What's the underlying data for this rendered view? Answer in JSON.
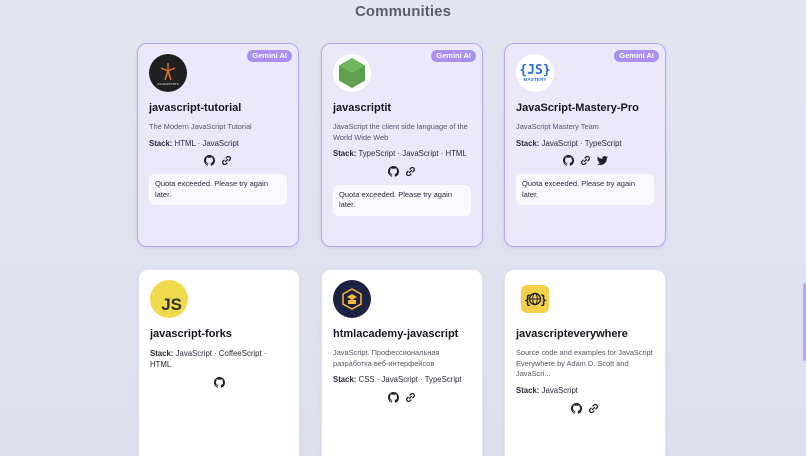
{
  "page": {
    "title": "Communities"
  },
  "cards": [
    {
      "name": "javascript-tutorial",
      "badge": "Gemini AI",
      "avatar_text": "JAVASCRIPT.INFO",
      "description": "The Modern JavaScript Tutorial",
      "stack_label": "Stack:",
      "stack": "HTML · JavaScript",
      "message": "Quota exceeded. Please try again later."
    },
    {
      "name": "javascriptit",
      "badge": "Gemini AI",
      "description": "JavaScript the client side language of the World Wide Web",
      "stack_label": "Stack:",
      "stack": "TypeScript · JavaScript · HTML",
      "message": "Quota exceeded. Please try again later."
    },
    {
      "name": "JavaScript-Mastery-Pro",
      "badge": "Gemini AI",
      "avatar_text": "{JS}",
      "avatar_subtext": "MASTERY",
      "description": "JavaScript Mastery Team",
      "stack_label": "Stack:",
      "stack": "JavaScript · TypeScript",
      "message": "Quota exceeded. Please try again later."
    },
    {
      "name": "javascript-forks",
      "avatar_text": "JS",
      "stack_label": "Stack:",
      "stack": "JavaScript · CoffeeScript · HTML"
    },
    {
      "name": "htmlacademy-javascript",
      "description": "JavaScript. Профессиональная разработка веб-интерфейсов",
      "stack_label": "Stack:",
      "stack": "CSS · JavaScript · TypeScript"
    },
    {
      "name": "javascripteverywhere",
      "description": "Source code and examples for JavaScript Everywhere by Adam D. Scott and JavaScri...",
      "stack_label": "Stack:",
      "stack": "JavaScript"
    }
  ],
  "colors": {
    "ai_card_bg": "#ece8fb",
    "ai_card_border": "#b9a8ef",
    "badge_bg": "#a88ff0",
    "plain_card_bg": "#ffffff"
  },
  "icons": [
    "github-icon",
    "link-icon",
    "twitter-icon"
  ]
}
